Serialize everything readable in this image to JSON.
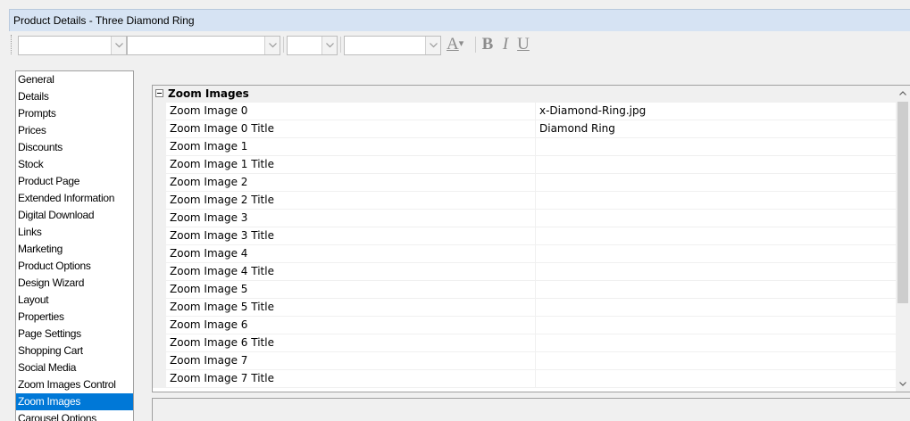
{
  "window": {
    "title": "Product Details - Three Diamond Ring"
  },
  "toolbar": {
    "font_combo_value": "",
    "style_combo_value": "",
    "size_combo_value": "",
    "color_combo_value": "",
    "font_color_glyph": "A",
    "bold_glyph": "B",
    "italic_glyph": "I",
    "underline_glyph": "U"
  },
  "nav": {
    "selected": "Zoom Images",
    "items": [
      "General",
      "Details",
      "Prompts",
      "Prices",
      "Discounts",
      "Stock",
      "Product Page",
      "Extended Information",
      "Digital Download",
      "Links",
      "Marketing",
      "Product Options",
      "Design Wizard",
      "Layout",
      "Properties",
      "Page Settings",
      "Shopping Cart",
      "Social Media",
      "Zoom Images Control",
      "Zoom Images",
      "Carousel Options"
    ]
  },
  "grid": {
    "category": "Zoom Images",
    "rows": [
      {
        "name": "Zoom Image 0",
        "value": "x-Diamond-Ring.jpg"
      },
      {
        "name": "Zoom Image 0 Title",
        "value": "Diamond Ring"
      },
      {
        "name": "Zoom Image 1",
        "value": ""
      },
      {
        "name": "Zoom Image 1 Title",
        "value": ""
      },
      {
        "name": "Zoom Image 2",
        "value": ""
      },
      {
        "name": "Zoom Image 2 Title",
        "value": ""
      },
      {
        "name": "Zoom Image 3",
        "value": ""
      },
      {
        "name": "Zoom Image 3 Title",
        "value": ""
      },
      {
        "name": "Zoom Image 4",
        "value": ""
      },
      {
        "name": "Zoom Image 4 Title",
        "value": ""
      },
      {
        "name": "Zoom Image 5",
        "value": ""
      },
      {
        "name": "Zoom Image 5 Title",
        "value": ""
      },
      {
        "name": "Zoom Image 6",
        "value": ""
      },
      {
        "name": "Zoom Image 6 Title",
        "value": ""
      },
      {
        "name": "Zoom Image 7",
        "value": ""
      },
      {
        "name": "Zoom Image 7 Title",
        "value": ""
      }
    ]
  },
  "colors": {
    "title_bar": "#d6e3f3",
    "selection": "#0078d7",
    "panel": "#f0f0f0"
  },
  "icons": {
    "expander": "collapse-icon",
    "scroll_up": "chevron-up-icon",
    "scroll_down": "chevron-down-icon",
    "combo_drop": "chevron-down-icon"
  }
}
